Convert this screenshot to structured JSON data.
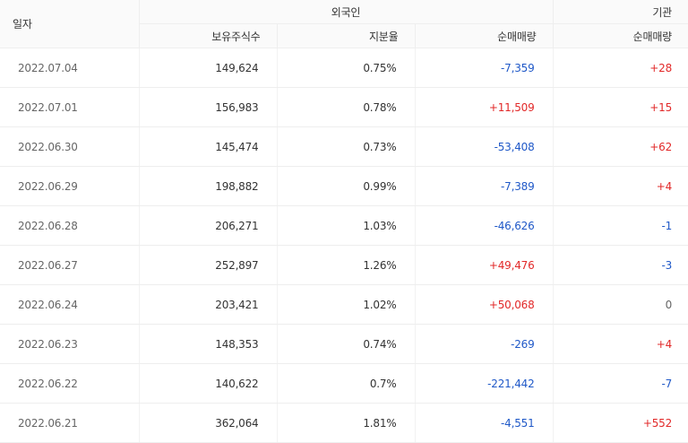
{
  "header": {
    "date_label": "일자",
    "foreign_group": "외국인",
    "inst_group": "기관",
    "holdings_label": "보유주식수",
    "ratio_label": "지분율",
    "foreign_net_label": "순매매량",
    "inst_net_label": "순매매량"
  },
  "colors": {
    "up": "#e22929",
    "down": "#2059c8",
    "flat": "#666666"
  },
  "rows": [
    {
      "date": "2022.07.04",
      "holdings": "149,624",
      "ratio": "0.75%",
      "foreign_net": "-7,359",
      "inst_net": "+28"
    },
    {
      "date": "2022.07.01",
      "holdings": "156,983",
      "ratio": "0.78%",
      "foreign_net": "+11,509",
      "inst_net": "+15"
    },
    {
      "date": "2022.06.30",
      "holdings": "145,474",
      "ratio": "0.73%",
      "foreign_net": "-53,408",
      "inst_net": "+62"
    },
    {
      "date": "2022.06.29",
      "holdings": "198,882",
      "ratio": "0.99%",
      "foreign_net": "-7,389",
      "inst_net": "+4"
    },
    {
      "date": "2022.06.28",
      "holdings": "206,271",
      "ratio": "1.03%",
      "foreign_net": "-46,626",
      "inst_net": "-1"
    },
    {
      "date": "2022.06.27",
      "holdings": "252,897",
      "ratio": "1.26%",
      "foreign_net": "+49,476",
      "inst_net": "-3"
    },
    {
      "date": "2022.06.24",
      "holdings": "203,421",
      "ratio": "1.02%",
      "foreign_net": "+50,068",
      "inst_net": "0"
    },
    {
      "date": "2022.06.23",
      "holdings": "148,353",
      "ratio": "0.74%",
      "foreign_net": "-269",
      "inst_net": "+4"
    },
    {
      "date": "2022.06.22",
      "holdings": "140,622",
      "ratio": "0.7%",
      "foreign_net": "-221,442",
      "inst_net": "-7"
    },
    {
      "date": "2022.06.21",
      "holdings": "362,064",
      "ratio": "1.81%",
      "foreign_net": "-4,551",
      "inst_net": "+552"
    }
  ]
}
